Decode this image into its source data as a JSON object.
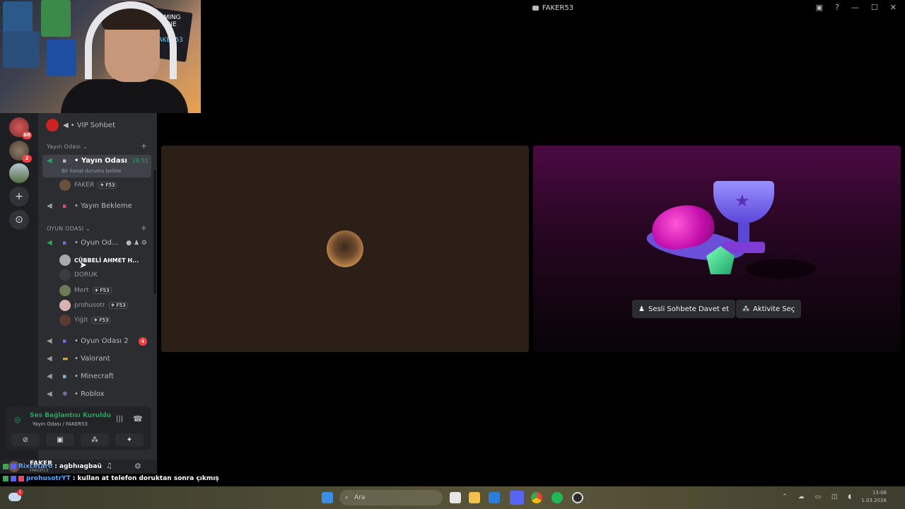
{
  "window": {
    "title": "FAKER53"
  },
  "webcam": {
    "poster_text": "GAMING ZONE",
    "poster_text2": "FAKER53"
  },
  "servers": [
    {
      "badge": "68"
    },
    {
      "badge": "2"
    }
  ],
  "channels": {
    "vip": "VIP Sohbet",
    "cat_yayin": "Yayın Odası",
    "yayin_odasi": "Yayın Odası",
    "yayin_timer": "28:51",
    "yayin_status": "Bir kanal durumu belirle",
    "yayin_user": "FAKER",
    "yayin_bekleme": "Yayın Bekleme",
    "cat_oyun": "OYUN ODASI",
    "oyun_odasi": "Oyun Od...",
    "users": [
      {
        "name": "CÜBBELİ AHMET H..."
      },
      {
        "name": "DORUK"
      },
      {
        "name": "Mert"
      },
      {
        "name": "prohusotr"
      },
      {
        "name": "Yiğit"
      }
    ],
    "tag": "F53",
    "oyun_odasi_2": "Oyun Odası 2",
    "oyun_odasi_2_badge": "4",
    "valorant": "Valorant",
    "minecraft": "Minecraft",
    "roblox": "Roblox"
  },
  "voice": {
    "status": "Ses Bağlantısı Kuruldu",
    "sub": "Yayın Odası / FAKER53"
  },
  "userbar": {
    "name": "FAKER",
    "sub": "FAKER53"
  },
  "chat": [
    {
      "user": "Rixcetaro",
      "msg": ": agbhıagbaü"
    },
    {
      "user": "prohusotrYT",
      "msg": ": kullan at telefon doruktan sonra çıkmış"
    }
  ],
  "activity": {
    "invite": "Sesli Sohbete Davet et",
    "choose": "Aktivite Seç"
  },
  "taskbar": {
    "search_placeholder": "Ara",
    "time": "13:06",
    "date": "1.03.2026",
    "notif_badge": "1"
  },
  "colors": {
    "accent_green": "#23a55a",
    "discord_blurple": "#5865f2",
    "danger": "#f23f43"
  }
}
